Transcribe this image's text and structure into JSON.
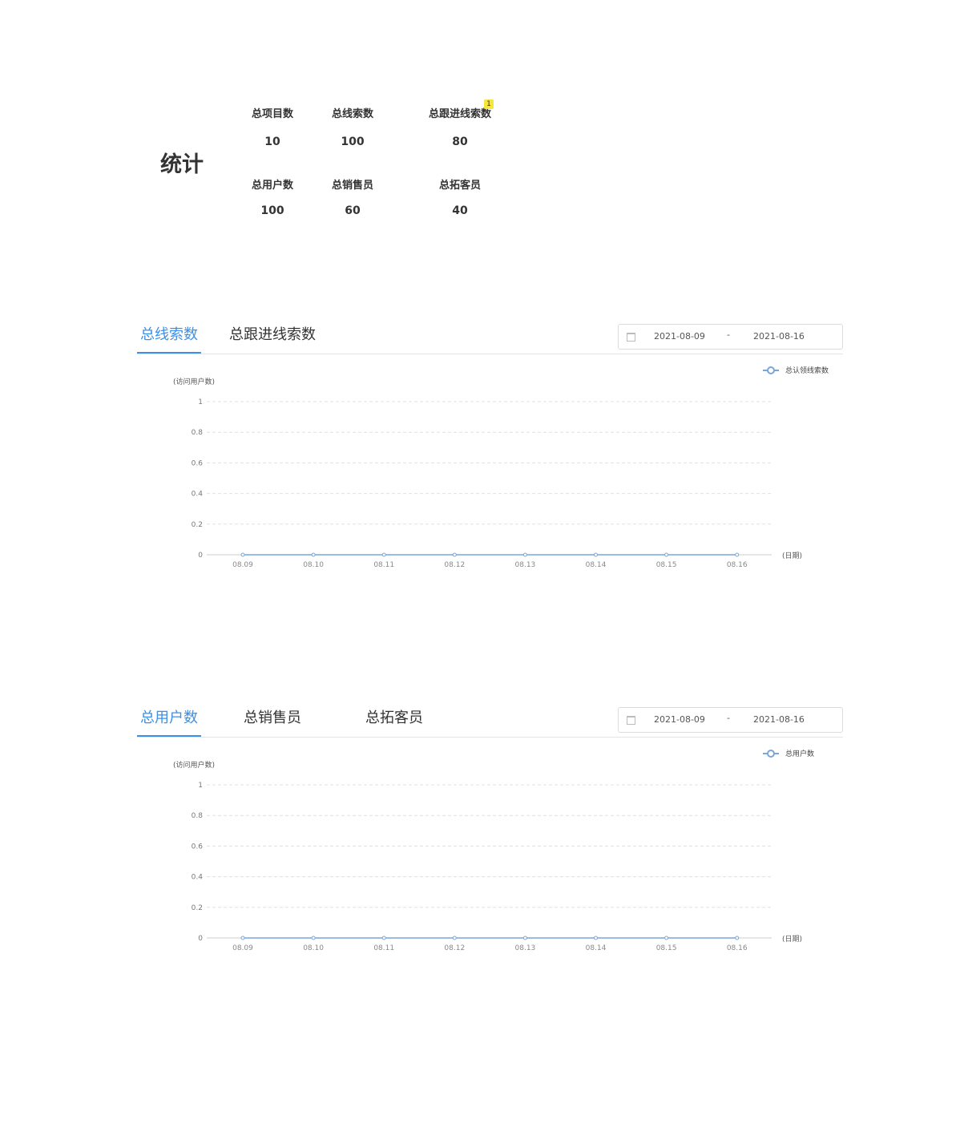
{
  "stats": {
    "title": "统计",
    "items": [
      {
        "label": "总项目数",
        "value": "10"
      },
      {
        "label": "总线索数",
        "value": "100"
      },
      {
        "label": "总跟进线索数",
        "value": "80",
        "badge": "1"
      },
      {
        "label": "总用户数",
        "value": "100"
      },
      {
        "label": "总销售员",
        "value": "60"
      },
      {
        "label": "总拓客员",
        "value": "40"
      }
    ]
  },
  "panel1": {
    "tabs": [
      "总线索数",
      "总跟进线索数"
    ],
    "range": {
      "start": "2021-08-09",
      "separator": "-",
      "end": "2021-08-16"
    }
  },
  "panel2": {
    "tabs": [
      "总用户数",
      "总销售员",
      "总拓客员"
    ],
    "range": {
      "start": "2021-08-09",
      "separator": "-",
      "end": "2021-08-16"
    }
  },
  "colors": {
    "accent": "#3e8fe6",
    "line": "#7aa6d8"
  },
  "chart_data": [
    {
      "type": "line",
      "ylabel": "(访问用户数)",
      "xlabel": "(日期)",
      "ylim": [
        0,
        1
      ],
      "yticks": [
        "0",
        "0.2",
        "0.4",
        "0.6",
        "0.8",
        "1"
      ],
      "categories": [
        "08.09",
        "08.10",
        "08.11",
        "08.12",
        "08.13",
        "08.14",
        "08.15",
        "08.16"
      ],
      "series": [
        {
          "name": "总认领线索数",
          "values": [
            0,
            0,
            0,
            0,
            0,
            0,
            0,
            0
          ]
        }
      ],
      "legend": "top-right",
      "grid": true
    },
    {
      "type": "line",
      "ylabel": "(访问用户数)",
      "xlabel": "(日期)",
      "ylim": [
        0,
        1
      ],
      "yticks": [
        "0",
        "0.2",
        "0.4",
        "0.6",
        "0.8",
        "1"
      ],
      "categories": [
        "08.09",
        "08.10",
        "08.11",
        "08.12",
        "08.13",
        "08.14",
        "08.15",
        "08.16"
      ],
      "series": [
        {
          "name": "总用户数",
          "values": [
            0,
            0,
            0,
            0,
            0,
            0,
            0,
            0
          ]
        }
      ],
      "legend": "top-right",
      "grid": true
    }
  ]
}
